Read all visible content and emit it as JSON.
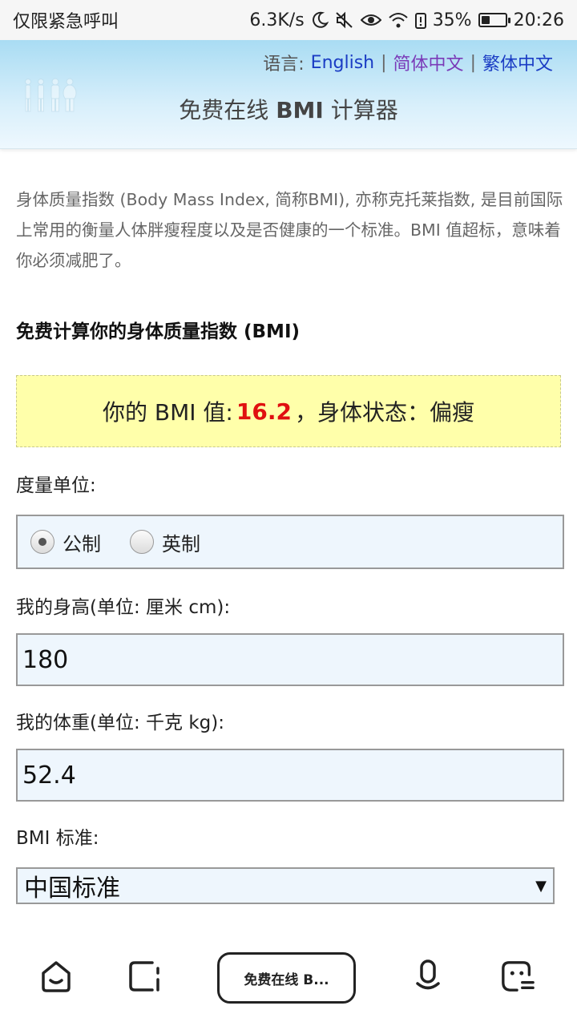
{
  "status_bar": {
    "carrier": "仅限紧急呼叫",
    "speed": "6.3K/s",
    "battery_pct": "35%",
    "time": "20:26",
    "battery_level": 0.35
  },
  "header": {
    "lang_label": "语言:",
    "lang_english": "English",
    "lang_simplified": "简体中文",
    "lang_traditional": "繁体中文",
    "title_pre": "免费在线 ",
    "title_bold": "BMI",
    "title_post": " 计算器"
  },
  "main": {
    "intro": "身体质量指数 (Body Mass Index, 简称BMI), 亦称克托莱指数, 是目前国际上常用的衡量人体胖瘦程度以及是否健康的一个标准。BMI 值超标，意味着你必须减肥了。",
    "section_heading": "免费计算你的身体质量指数 (BMI)",
    "result": {
      "prefix": "你的 BMI 值:",
      "value": "16.2",
      "suffix": "，身体状态：偏瘦"
    },
    "unit_label": "度量单位:",
    "unit_metric": "公制",
    "unit_imperial": "英制",
    "height_label": "我的身高(单位: 厘米 cm):",
    "height_value": "180",
    "weight_label": "我的体重(单位: 千克 kg):",
    "weight_value": "52.4",
    "standard_label": "BMI 标准:",
    "standard_value": "中国标准"
  },
  "bottom_nav": {
    "tab_label": "免费在线 B..."
  }
}
